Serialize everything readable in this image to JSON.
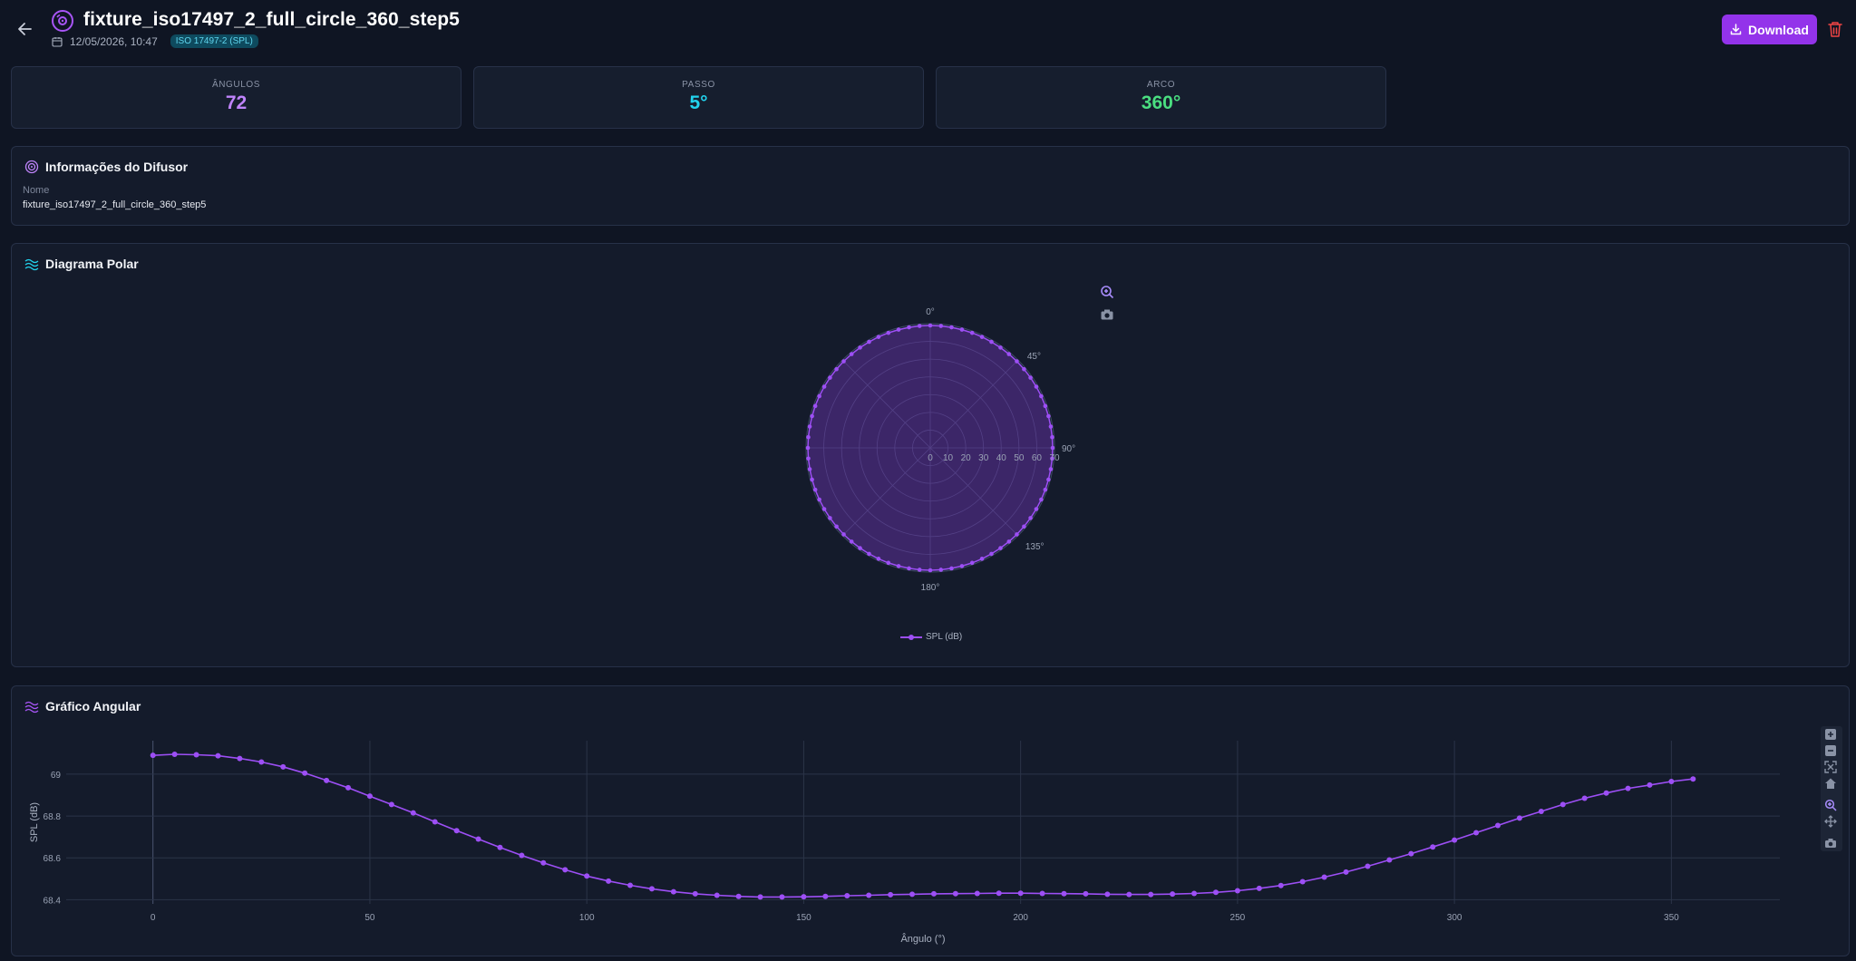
{
  "header": {
    "title": "fixture_iso17497_2_full_circle_360_step5",
    "date": "12/05/2026, 10:47",
    "badge": "ISO 17497-2 (SPL)",
    "download_label": "Download"
  },
  "stats": [
    {
      "label": "ÂNGULOS",
      "value": "72",
      "color": "#c084fc"
    },
    {
      "label": "PASSO",
      "value": "5°",
      "color": "#22d3ee"
    },
    {
      "label": "ARCO",
      "value": "360°",
      "color": "#4ade80"
    }
  ],
  "info": {
    "title": "Informações do Difusor",
    "name_label": "Nome",
    "name_value": "fixture_iso17497_2_full_circle_360_step5"
  },
  "polar": {
    "title": "Diagrama Polar",
    "legend": "SPL (dB)"
  },
  "angular": {
    "title": "Gráfico Angular"
  },
  "colors": {
    "accent": "#9333ea",
    "series": "#9d4ff5",
    "danger": "#ef4444"
  },
  "chart_data": [
    {
      "type": "polar",
      "radial_ticks": [
        "0",
        "10",
        "20",
        "30",
        "40",
        "50",
        "60",
        "70"
      ],
      "radial_range": [
        0,
        70
      ],
      "angular_ticks": [
        "0°",
        "45°",
        "90°",
        "135°",
        "180°"
      ],
      "series": [
        {
          "name": "SPL (dB)",
          "theta_start": 0,
          "theta_step": 5,
          "count": 72
        }
      ]
    },
    {
      "type": "line",
      "xlabel": "Ângulo (°)",
      "ylabel": "SPL (dB)",
      "xlim": [
        -20,
        375
      ],
      "ylim": [
        68.38,
        69.16
      ],
      "x_ticks": [
        0,
        50,
        100,
        150,
        200,
        250,
        300,
        350
      ],
      "y_ticks": [
        68.4,
        68.6,
        68.8,
        69
      ],
      "y_tick_labels": [
        "68.4",
        "68.6",
        "68.8",
        "69"
      ],
      "x": [
        0,
        5,
        10,
        15,
        20,
        25,
        30,
        35,
        40,
        45,
        50,
        55,
        60,
        65,
        70,
        75,
        80,
        85,
        90,
        95,
        100,
        105,
        110,
        115,
        120,
        125,
        130,
        135,
        140,
        145,
        150,
        155,
        160,
        165,
        170,
        175,
        180,
        185,
        190,
        195,
        200,
        205,
        210,
        215,
        220,
        225,
        230,
        235,
        240,
        245,
        250,
        255,
        260,
        265,
        270,
        275,
        280,
        285,
        290,
        295,
        300,
        305,
        310,
        315,
        320,
        325,
        330,
        335,
        340,
        345,
        350,
        355
      ],
      "y": [
        69.09,
        69.095,
        69.093,
        69.088,
        69.075,
        69.058,
        69.035,
        69.005,
        68.97,
        68.935,
        68.895,
        68.855,
        68.815,
        68.772,
        68.73,
        68.69,
        68.65,
        68.612,
        68.576,
        68.543,
        68.513,
        68.489,
        68.469,
        68.452,
        68.438,
        68.428,
        68.421,
        68.416,
        68.413,
        68.413,
        68.414,
        68.416,
        68.419,
        68.421,
        68.424,
        68.426,
        68.428,
        68.429,
        68.43,
        68.431,
        68.431,
        68.43,
        68.429,
        68.428,
        68.426,
        68.425,
        68.425,
        68.427,
        68.43,
        68.435,
        68.443,
        68.454,
        68.468,
        68.486,
        68.508,
        68.532,
        68.56,
        68.59,
        68.62,
        68.652,
        68.685,
        68.72,
        68.755,
        68.79,
        68.822,
        68.855,
        68.885,
        68.91,
        68.932,
        68.948,
        68.965,
        68.977,
        68.985
      ]
    }
  ]
}
